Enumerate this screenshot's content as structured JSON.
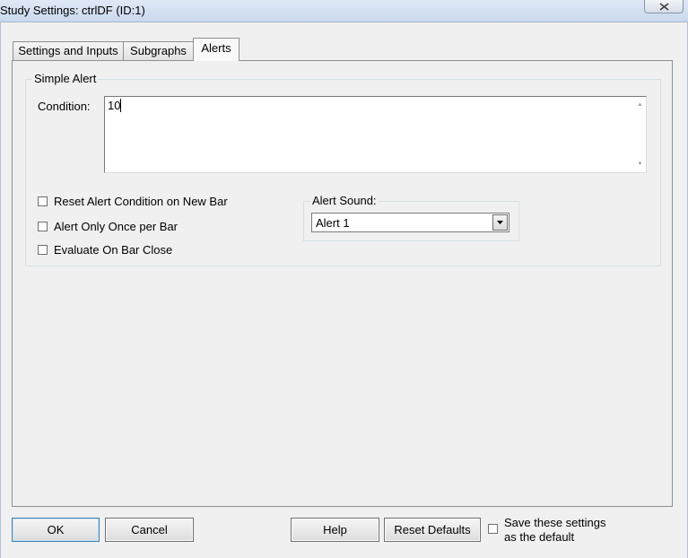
{
  "window": {
    "title": "Study Settings: ctrlDF (ID:1)",
    "close_icon": "x-close-icon"
  },
  "tabs": [
    {
      "label": "Settings and Inputs",
      "active": false
    },
    {
      "label": "Subgraphs",
      "active": false
    },
    {
      "label": "Alerts",
      "active": true
    }
  ],
  "simple_alert": {
    "group_label": "Simple Alert",
    "condition_label": "Condition:",
    "condition_value": "10",
    "checkboxes": [
      {
        "label": "Reset Alert Condition on New Bar",
        "checked": false
      },
      {
        "label": "Alert Only Once per Bar",
        "checked": false
      },
      {
        "label": "Evaluate On Bar Close",
        "checked": false
      }
    ],
    "sound_group_label": "Alert Sound:",
    "sound_selected": "Alert 1"
  },
  "buttons": {
    "ok": "OK",
    "cancel": "Cancel",
    "help": "Help",
    "reset_defaults": "Reset Defaults"
  },
  "save_default": {
    "label_line1": "Save these settings",
    "label_line2": "as the default",
    "checked": false
  }
}
